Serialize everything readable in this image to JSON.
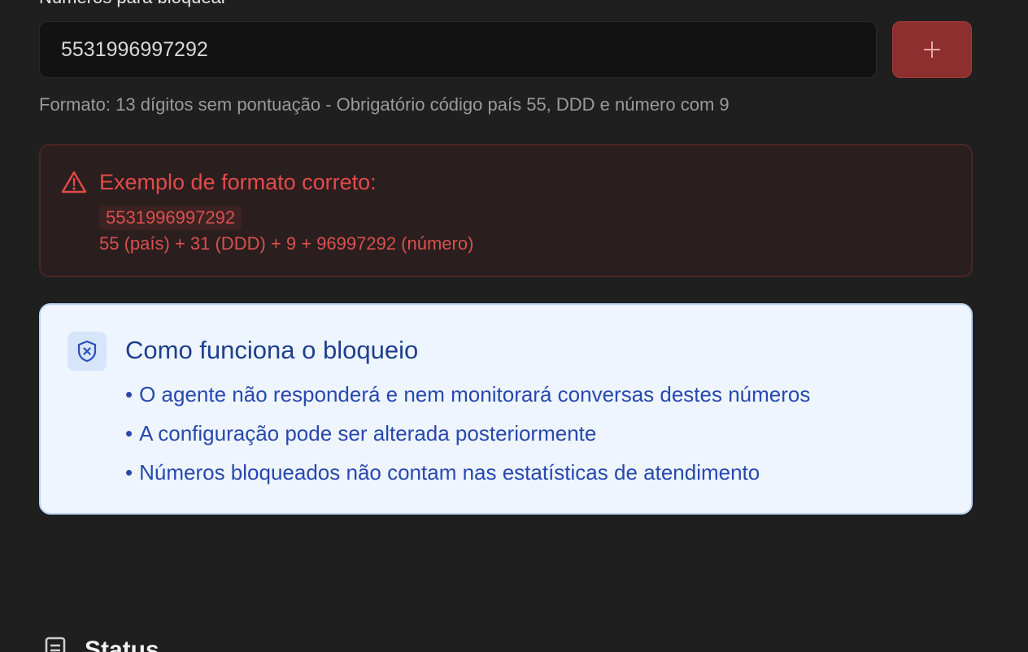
{
  "section": {
    "label": "Números para bloquear"
  },
  "phone_input": {
    "value": "5531996997292",
    "add_button_label": "+"
  },
  "format_hint": "Formato: 13 dígitos sem pontuação - Obrigatório código país 55, DDD e número com 9",
  "example": {
    "title": "Exemplo de formato correto:",
    "code": "5531996997292",
    "breakdown": "55 (país) + 31 (DDD) + 9 + 96997292 (número)",
    "icon": "warning-triangle-icon"
  },
  "info": {
    "title": "Como funciona o bloqueio",
    "icon": "shield-x-icon",
    "items": [
      "O agente não responderá e nem monitorará conversas destes números",
      "A configuração pode ser alterada posteriormente",
      "Números bloqueados não contam nas estatísticas de atendimento"
    ],
    "bullet": "•"
  },
  "status": {
    "title": "Status",
    "icon": "clipboard-icon"
  },
  "colors": {
    "background": "#1f1f1f",
    "danger": "#e24b4b",
    "info_blue": "#2848b0"
  }
}
